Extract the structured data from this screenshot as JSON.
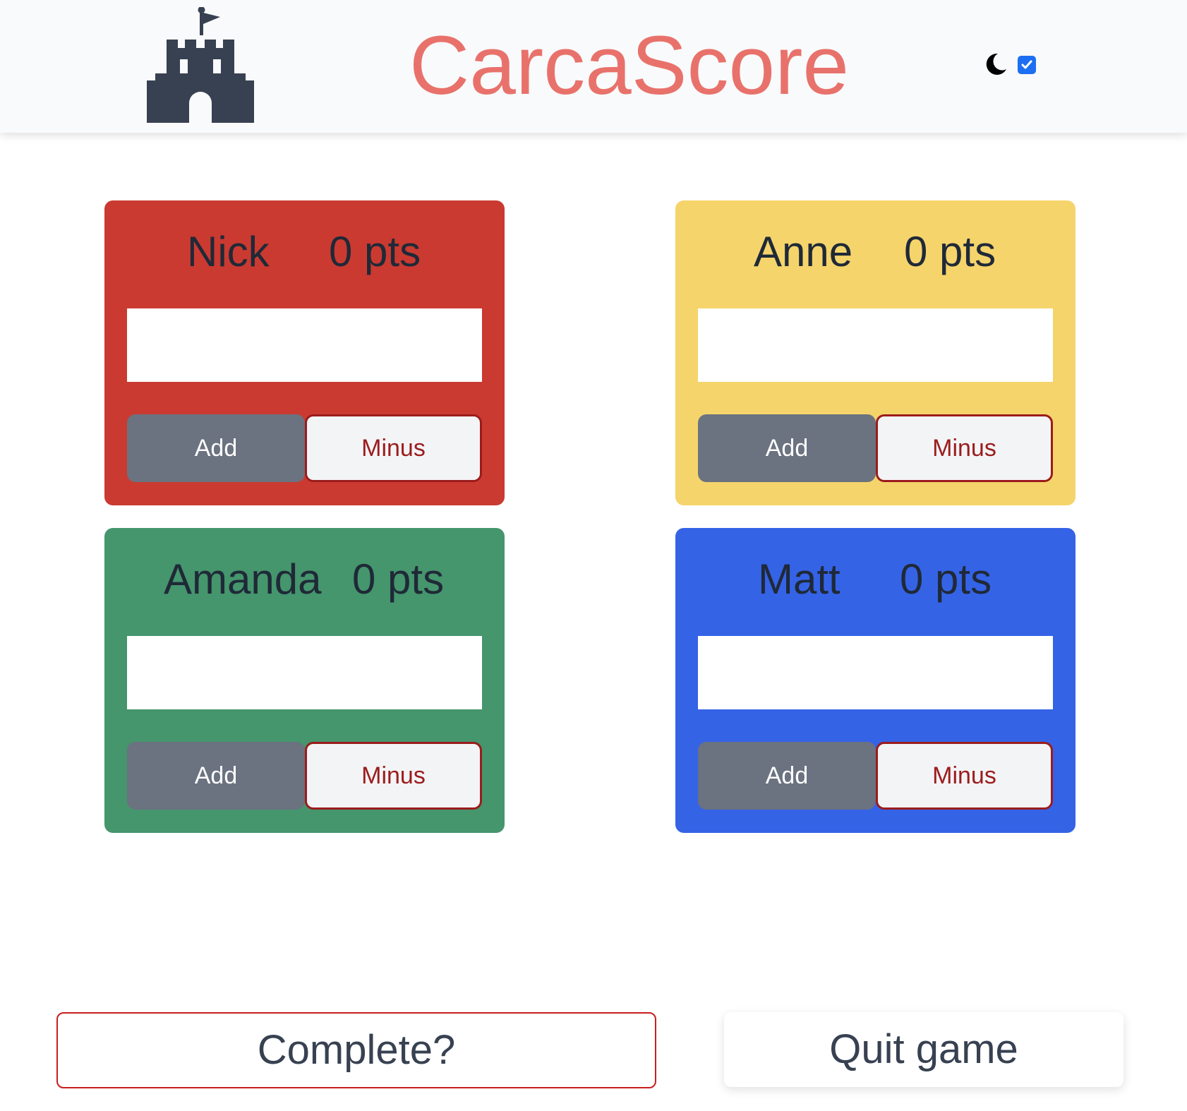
{
  "header": {
    "logo_icon": "castle-icon",
    "title": "CarcaScore",
    "title_color": "#e8726b",
    "dark_mode_icon": "moon-icon",
    "dark_mode_checked": true
  },
  "players": [
    {
      "name": "Nick",
      "score": "0 pts",
      "color": "#ca3a31",
      "add_label": "Add",
      "minus_label": "Minus",
      "input_value": ""
    },
    {
      "name": "Anne",
      "score": "0 pts",
      "color": "#f5d46b",
      "add_label": "Add",
      "minus_label": "Minus",
      "input_value": ""
    },
    {
      "name": "Amanda",
      "score": "0 pts",
      "color": "#45956d",
      "add_label": "Add",
      "minus_label": "Minus",
      "input_value": ""
    },
    {
      "name": "Matt",
      "score": "0 pts",
      "color": "#3563e6",
      "add_label": "Add",
      "minus_label": "Minus",
      "input_value": ""
    }
  ],
  "footer": {
    "complete_label": "Complete?",
    "quit_label": "Quit game"
  }
}
